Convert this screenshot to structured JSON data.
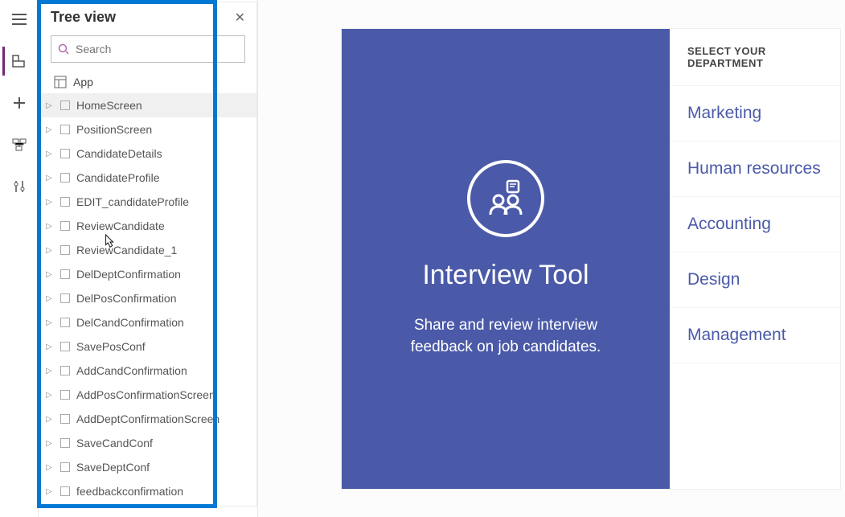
{
  "panel": {
    "title": "Tree view",
    "search_placeholder": "Search",
    "app_label": "App"
  },
  "tree_items": [
    {
      "label": "HomeScreen",
      "selected": true,
      "ellipsis": true
    },
    {
      "label": "PositionScreen"
    },
    {
      "label": "CandidateDetails"
    },
    {
      "label": "CandidateProfile"
    },
    {
      "label": "EDIT_candidateProfile"
    },
    {
      "label": "ReviewCandidate",
      "ellipsis": true
    },
    {
      "label": "ReviewCandidate_1"
    },
    {
      "label": "DelDeptConfirmation"
    },
    {
      "label": "DelPosConfirmation"
    },
    {
      "label": "DelCandConfirmation"
    },
    {
      "label": "SavePosConf"
    },
    {
      "label": "AddCandConfirmation"
    },
    {
      "label": "AddPosConfirmationScreen"
    },
    {
      "label": "AddDeptConfirmationScreen"
    },
    {
      "label": "SaveCandConf"
    },
    {
      "label": "SaveDeptConf"
    },
    {
      "label": "feedbackconfirmation"
    }
  ],
  "preview": {
    "title": "Interview Tool",
    "description": "Share and review interview feedback on job candidates.",
    "dept_header": "SELECT YOUR DEPARTMENT",
    "departments": [
      "Marketing",
      "Human resources",
      "Accounting",
      "Design",
      "Management"
    ]
  }
}
